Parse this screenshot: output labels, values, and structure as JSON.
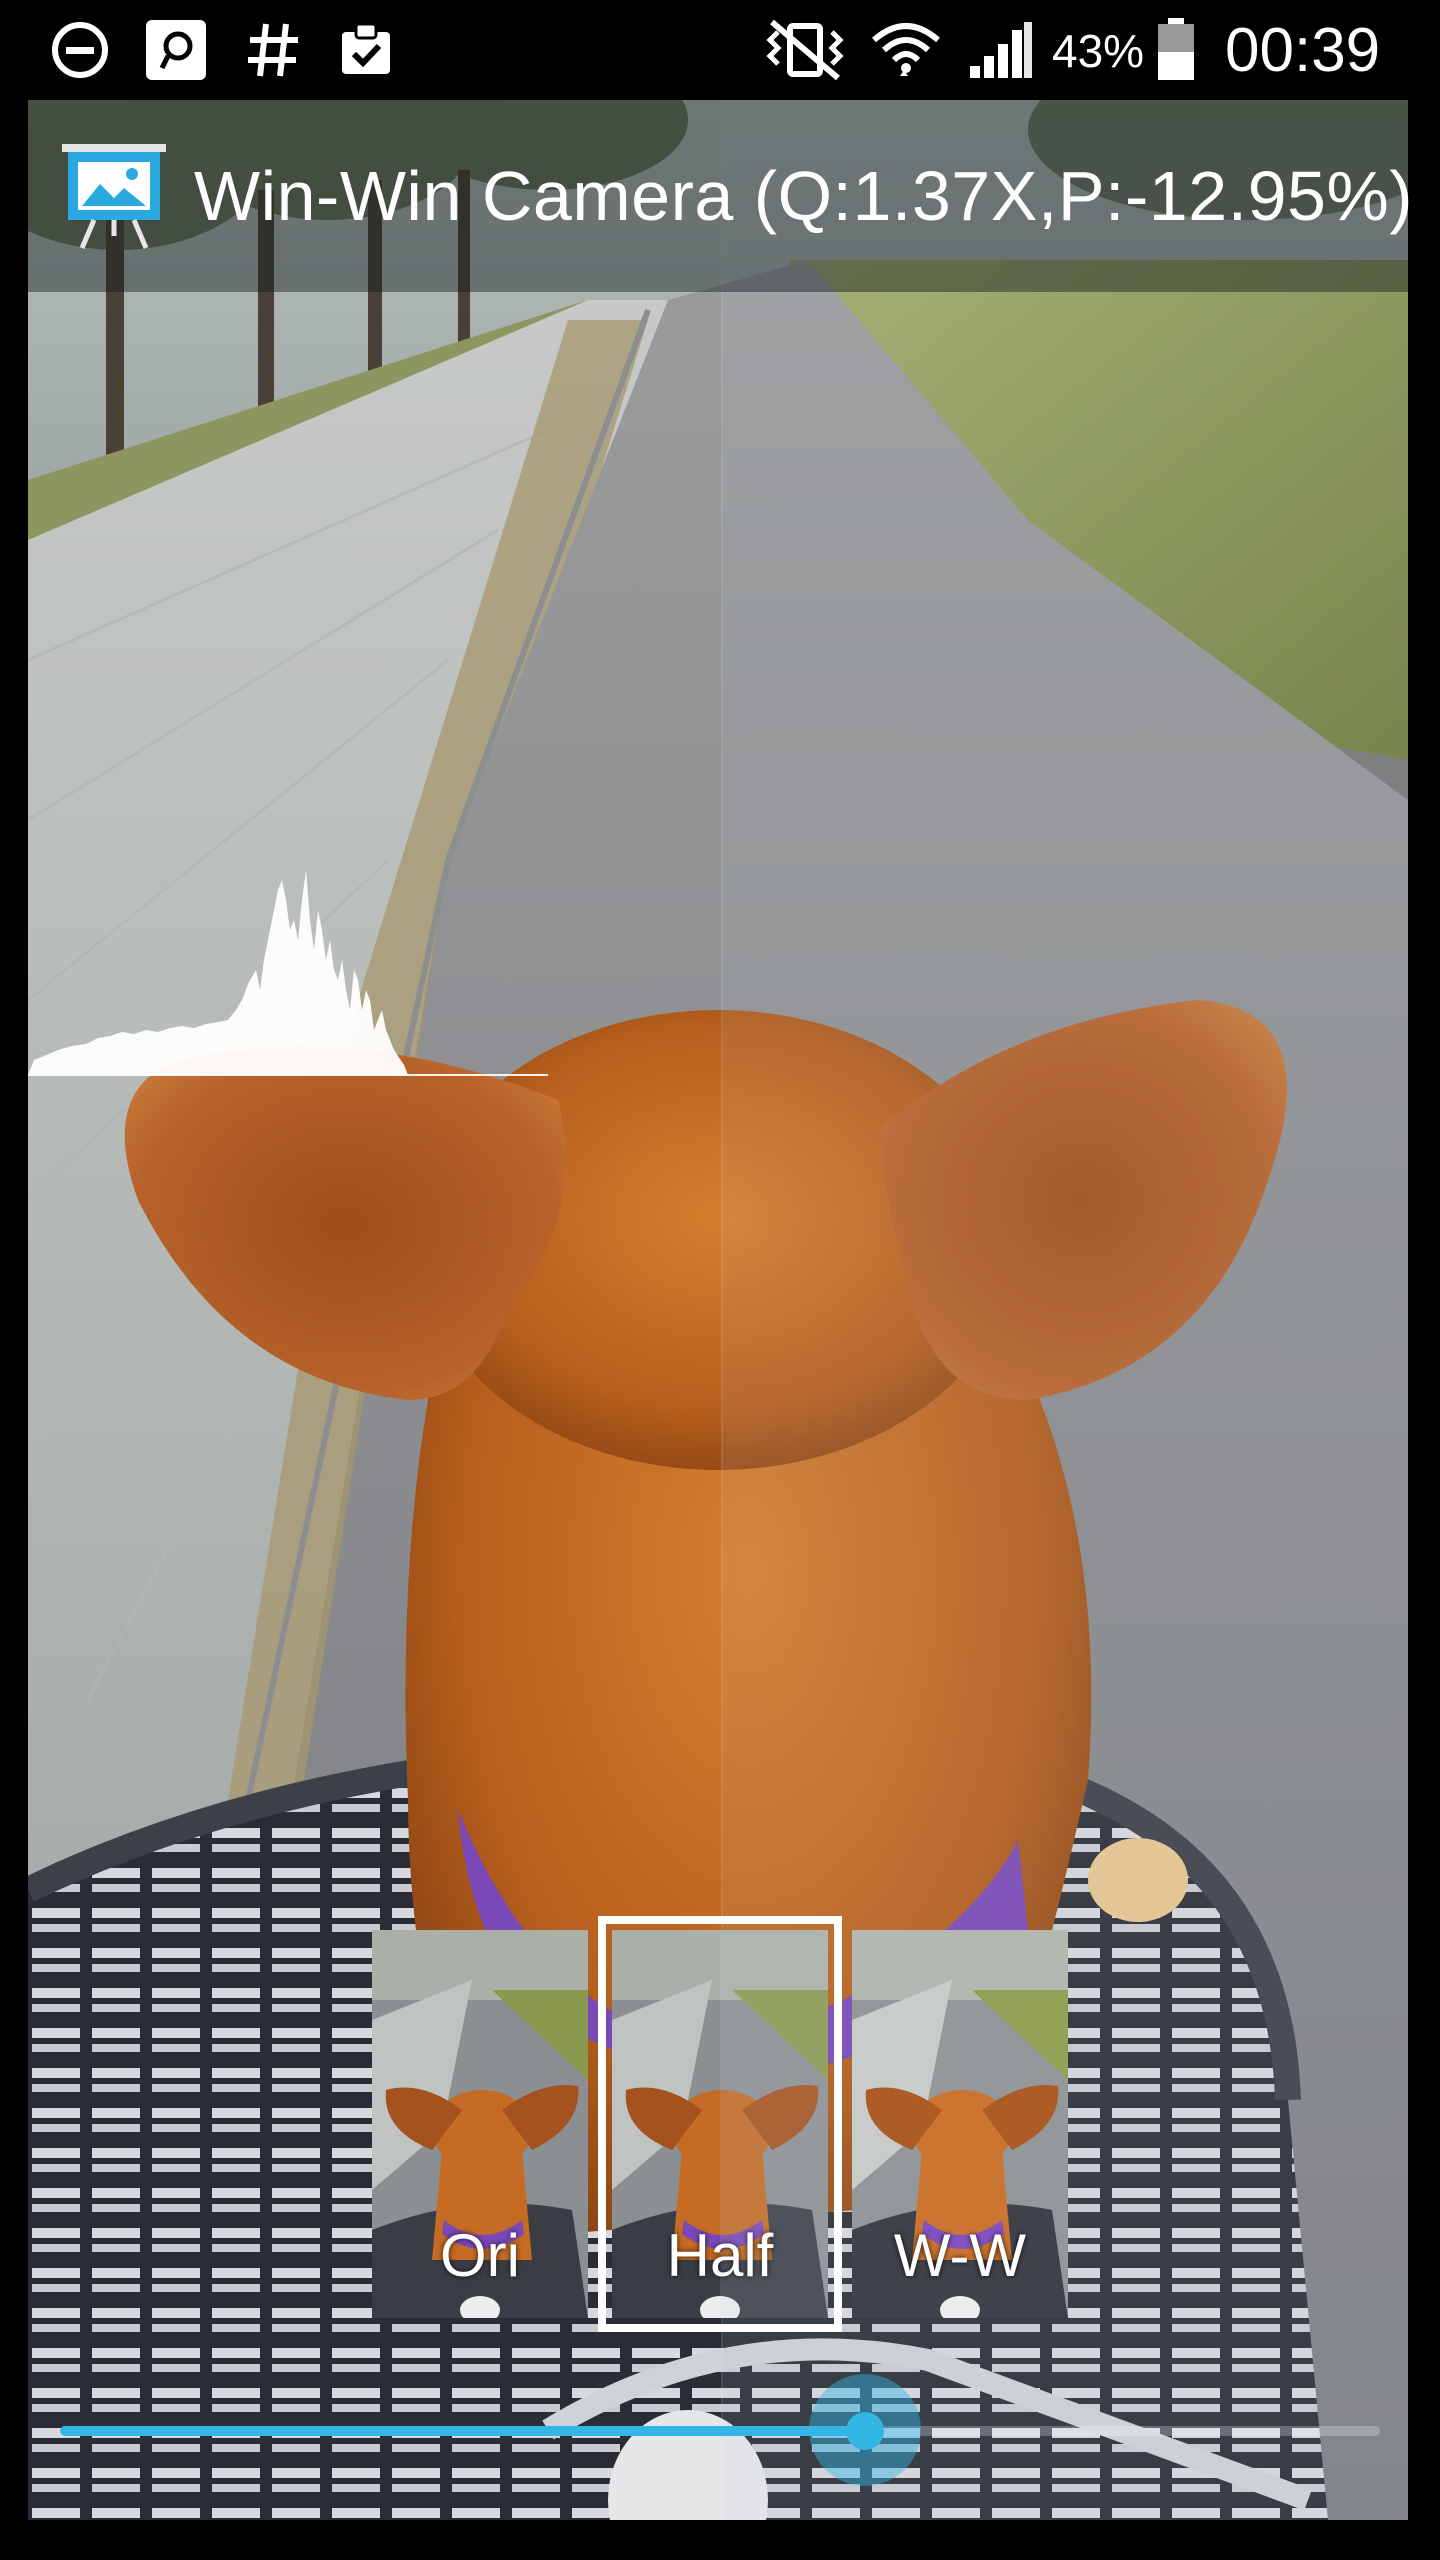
{
  "status_bar": {
    "left_icons": [
      "do-not-disturb-icon",
      "ring-chat-icon",
      "hashtag-icon",
      "clipboard-check-icon"
    ],
    "right_icons": [
      "vibrate-mute-icon",
      "wifi-icon",
      "cell-signal-icon",
      "battery-icon"
    ],
    "battery_percent": "43%",
    "battery_level": 0.43,
    "time": "00:39"
  },
  "action_bar": {
    "app_icon": "presentation-picture-icon",
    "title": "Win-Win Camera (Q:1.37X,P:-12.95%)"
  },
  "histogram": {
    "icon": "luminance-histogram"
  },
  "modes": {
    "items": [
      {
        "label": "Ori",
        "selected": false
      },
      {
        "label": "Half",
        "selected": true
      },
      {
        "label": "W-W",
        "selected": false
      }
    ]
  },
  "slider": {
    "value": 0.61
  },
  "colors": {
    "accent": "#33b5e5",
    "status_bar_bg": "#000000",
    "text": "#ffffff"
  }
}
